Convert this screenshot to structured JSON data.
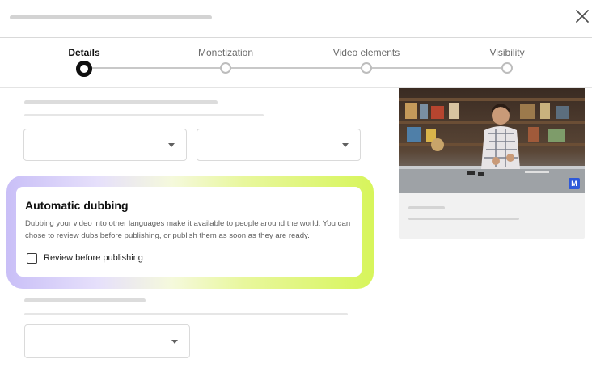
{
  "stepper": {
    "steps": [
      {
        "label": "Details"
      },
      {
        "label": "Monetization"
      },
      {
        "label": "Video elements"
      },
      {
        "label": "Visibility"
      }
    ],
    "active_index": 0
  },
  "dubbing": {
    "title": "Automatic dubbing",
    "description": "Dubbing your video into other languages make it available to people around the world. You can chose to review dubs before publishing, or publish them as soon as they are ready.",
    "checkbox_label": "Review before publishing",
    "checkbox_checked": false
  },
  "preview": {
    "badge": "M"
  },
  "colors": {
    "glow_start": "#c9bff7",
    "glow_end": "#d7f55b",
    "active_step": "#0f0f0f",
    "badge": "#2e59d9"
  },
  "icons": [
    "close-icon",
    "chevron-down-icon"
  ]
}
